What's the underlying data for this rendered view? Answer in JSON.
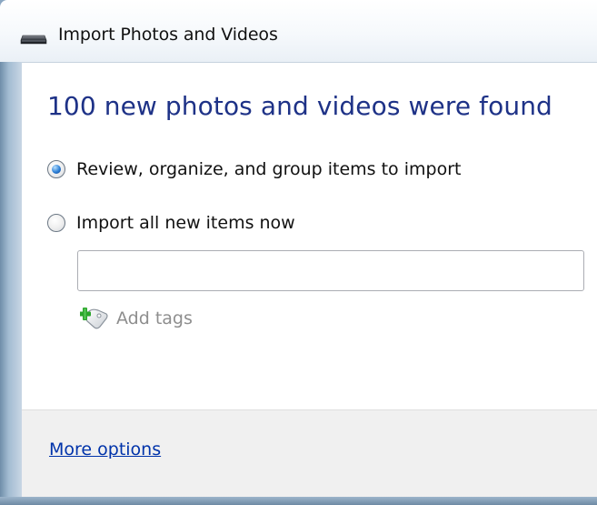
{
  "window": {
    "title": "Import Photos and Videos",
    "title_icon": "drive-icon"
  },
  "main": {
    "heading": "100 new photos and videos were found",
    "options": [
      {
        "label": "Review, organize, and group items to import",
        "selected": true
      },
      {
        "label": "Import all new items now",
        "selected": false
      }
    ],
    "tags_input": {
      "value": "",
      "placeholder": ""
    },
    "add_tags": {
      "label": "Add tags",
      "icon": "add-tag-icon"
    }
  },
  "footer": {
    "more_options_label": "More options"
  },
  "colors": {
    "heading": "#1e3287",
    "link": "#0033aa",
    "disabled_text": "#8e8e8e",
    "footer_bg": "#f0f0f0"
  }
}
